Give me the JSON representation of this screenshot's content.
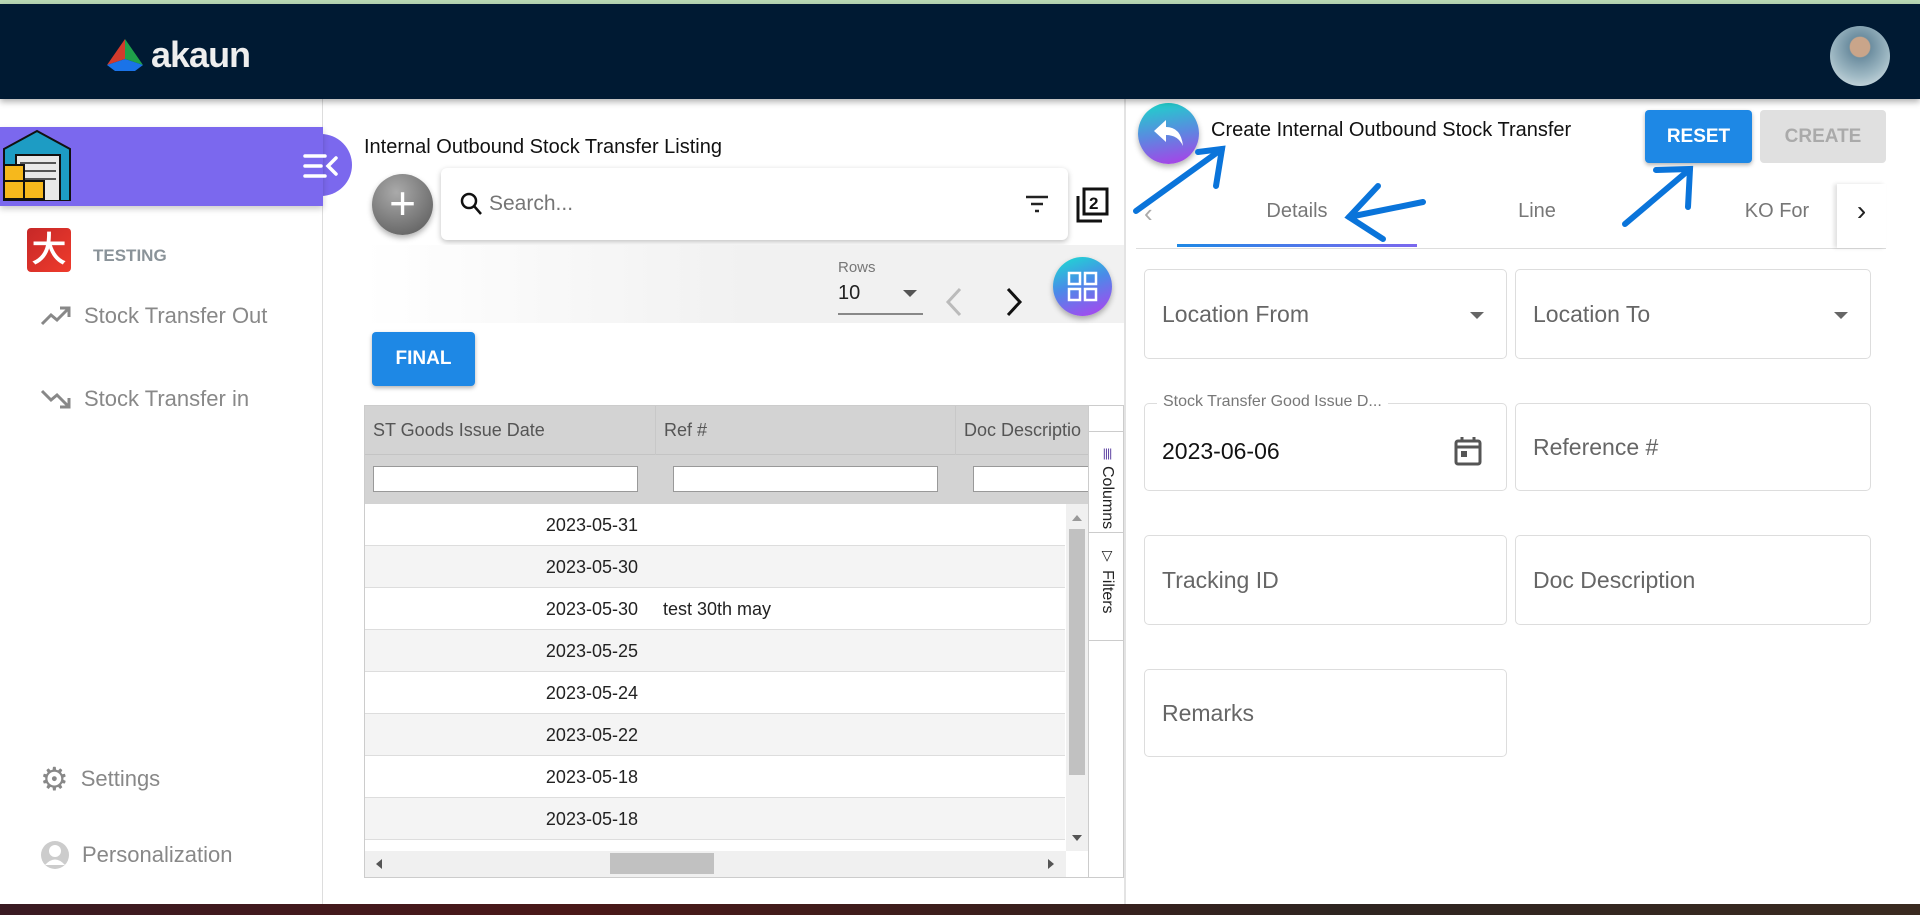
{
  "header": {
    "logo_text": "akaun"
  },
  "sidebar": {
    "applet_title": "Stock Transfer Applet",
    "org_label": "TESTING",
    "items": [
      {
        "label": "Stock Transfer Out"
      },
      {
        "label": "Stock Transfer in"
      }
    ],
    "bottom": [
      {
        "label": "Settings"
      },
      {
        "label": "Personalization"
      }
    ]
  },
  "listing": {
    "title": "Internal Outbound Stock Transfer Listing",
    "search_placeholder": "Search...",
    "rows_label": "Rows",
    "rows_value": "10",
    "final_label": "FINAL",
    "columns": [
      "ST Goods Issue Date",
      "Ref #",
      "Doc Descriptio"
    ],
    "rows": [
      {
        "date": "2023-05-31",
        "ref": ""
      },
      {
        "date": "2023-05-30",
        "ref": ""
      },
      {
        "date": "2023-05-30",
        "ref": "test 30th may"
      },
      {
        "date": "2023-05-25",
        "ref": ""
      },
      {
        "date": "2023-05-24",
        "ref": ""
      },
      {
        "date": "2023-05-22",
        "ref": ""
      },
      {
        "date": "2023-05-18",
        "ref": ""
      },
      {
        "date": "2023-05-18",
        "ref": ""
      }
    ],
    "side_tabs": [
      "Columns",
      "Filters"
    ]
  },
  "form": {
    "title": "Create Internal Outbound Stock Transfer",
    "reset_label": "RESET",
    "create_label": "CREATE",
    "tabs": [
      "Details",
      "Line",
      "KO For"
    ],
    "fields": {
      "location_from": "Location From",
      "location_to": "Location To",
      "issue_date_label": "Stock Transfer Good Issue D...",
      "issue_date_value": "2023-06-06",
      "reference": "Reference #",
      "tracking_id": "Tracking ID",
      "doc_description": "Doc Description",
      "remarks": "Remarks"
    }
  },
  "colors": {
    "header": "#001a33",
    "accent": "#7b68ee",
    "primary": "#1e88e5",
    "annotation": "#0a74da"
  }
}
